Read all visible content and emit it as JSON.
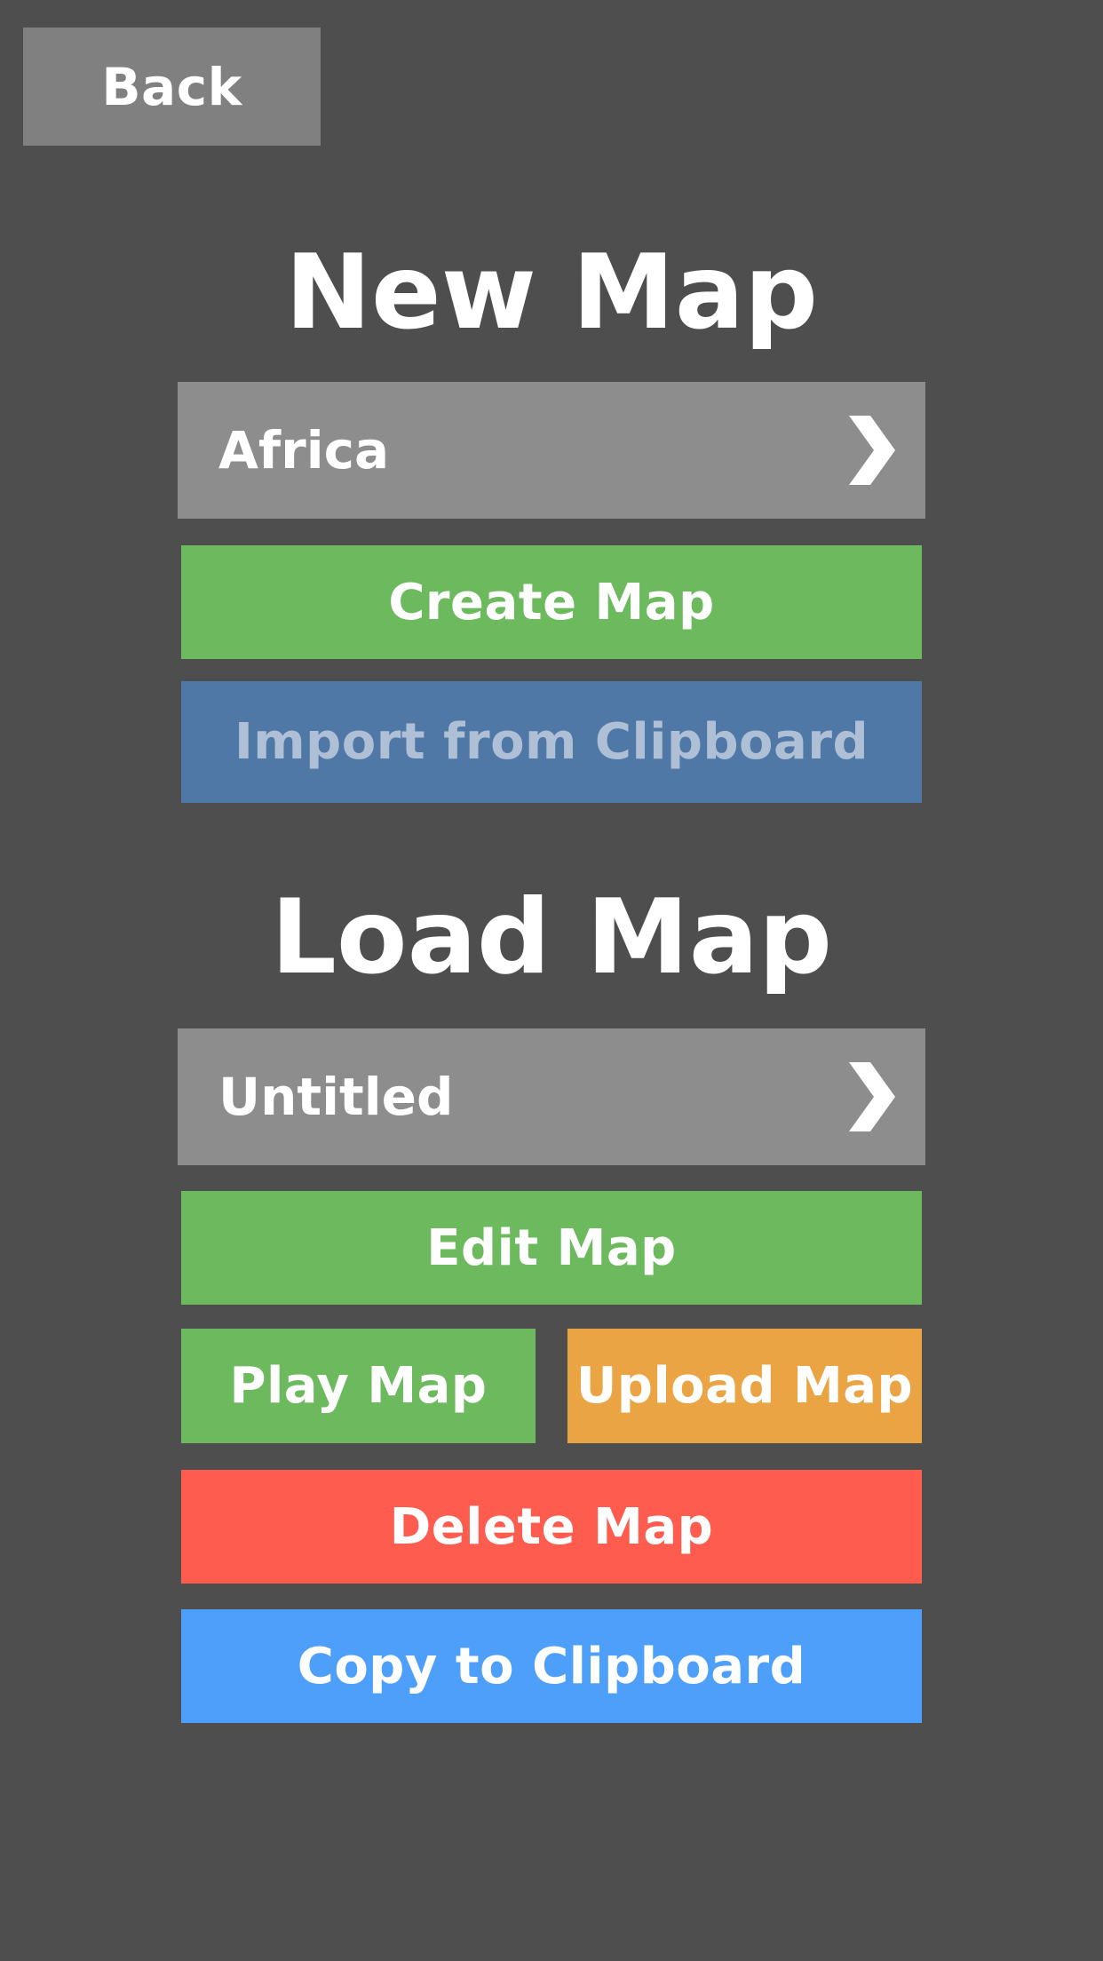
{
  "back_label": "Back",
  "new_map": {
    "heading": "New Map",
    "selected_template": "Africa",
    "create_label": "Create Map",
    "import_label": "Import from Clipboard"
  },
  "load_map": {
    "heading": "Load Map",
    "selected_map": "Untitled",
    "edit_label": "Edit Map",
    "play_label": "Play Map",
    "upload_label": "Upload Map",
    "delete_label": "Delete Map",
    "copy_label": "Copy to Clipboard"
  },
  "colors": {
    "background": "#4e4e4e",
    "green": "#6cb95e",
    "import_blue": "#4f78a6",
    "orange": "#eaa443",
    "red": "#fd5c4e",
    "blue": "#4e9ffa",
    "selector_gray": "#8d8d8d"
  },
  "icons": {
    "selector_arrow": "chevron-right-icon"
  }
}
